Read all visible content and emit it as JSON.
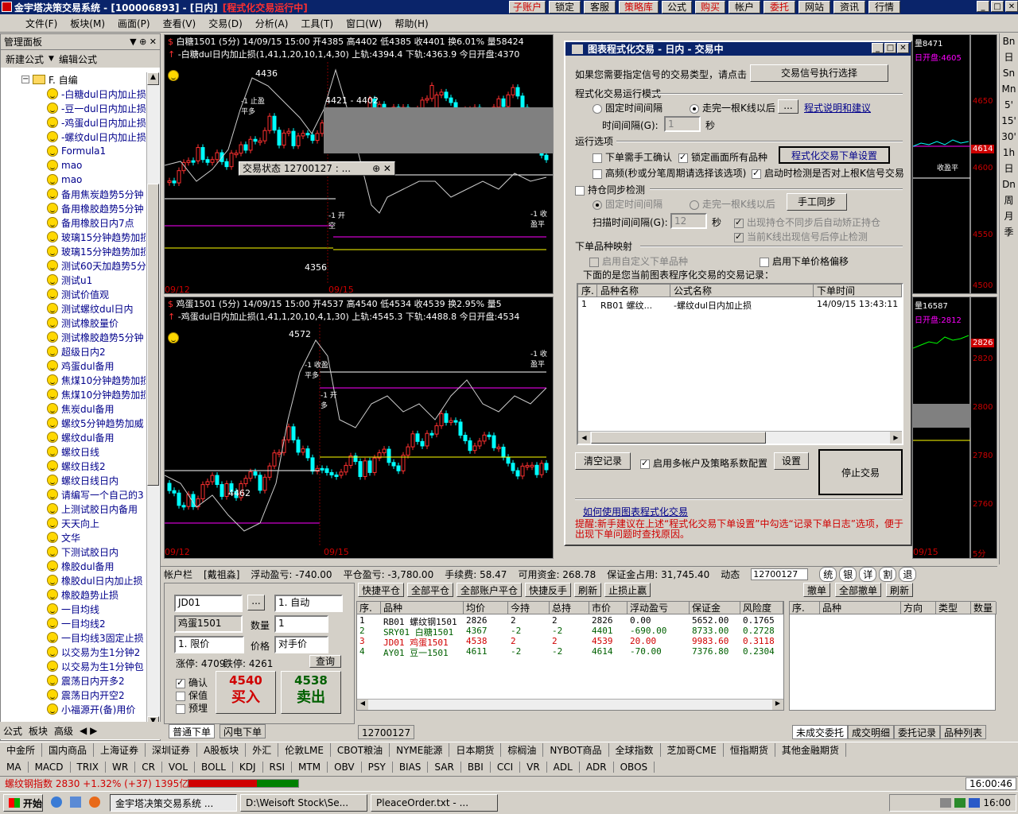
{
  "window": {
    "title": "金宇塔决策交易系统 - [100006893] - [日内]",
    "running_badge": "[程式化交易运行中]",
    "quick_buttons": [
      "子账户",
      "锁定",
      "客服",
      "策略库",
      "公式",
      "购买",
      "帐户",
      "委托",
      "网站",
      "资讯",
      "行情"
    ],
    "colors": {
      "title_bg": "#0a246a",
      "chart_bg": "#000000",
      "up": "#ff3030",
      "down": "#00ffff",
      "ui_face": "#d4d0c8"
    }
  },
  "menu": [
    "文件(F)",
    "板块(M)",
    "画面(P)",
    "查看(V)",
    "交易(D)",
    "分析(A)",
    "工具(T)",
    "窗口(W)",
    "帮助(H)"
  ],
  "left_panel": {
    "title": "管理面板",
    "new_formula": "新建公式",
    "edit_formula": "编辑公式",
    "folder": "F. 自编",
    "items": [
      "-白糖dul日内加止损",
      "-豆一dul日内加止损",
      "-鸡蛋dul日内加止损",
      "-螺纹dul日内加止损",
      "Formula1",
      "mao",
      "mao",
      "备用焦炭趋势5分钟",
      "备用橡胶趋势5分钟",
      "备用橡胶日内7点",
      "玻璃15分钟趋势加损",
      "玻璃15分钟趋势加损",
      "测试60天加趋势5分",
      "测试u1",
      "测试价值观",
      "测试螺纹dul日内",
      "测试橡胶量价",
      "测试橡胶趋势5分钟",
      "超级日内2",
      "鸡蛋dul备用",
      "焦煤10分钟趋势加损",
      "焦煤10分钟趋势加损",
      "焦炭dul备用",
      "螺纹5分钟趋势加威",
      "螺纹dul备用",
      "螺纹日线",
      "螺纹日线2",
      "螺纹日线日内",
      "请编写一个自己的3",
      "上测试胶日内备用",
      "天天向上",
      "文华",
      "下测试胶日内",
      "橡胶dul备用",
      "橡胶dul日内加止损",
      "橡胶趋势止损",
      "一目均线",
      "一目均线2",
      "一目均线3固定止损",
      "以交易为生1分钟2",
      "以交易为生1分钟包",
      "震荡日内开多2",
      "震荡日内开空2",
      "小福源开(备)用价"
    ],
    "tabs": [
      "公式",
      "板块",
      "高级"
    ]
  },
  "chart_top": {
    "header": "白糖1501 (5分) 14/09/15 15:00 开4385 高4402 低4385 收4401 换6.01% 量58424",
    "formula": "-白糖dul日内加止损(1,41,1,20,10,1,4,30) 上轨:4394.4 下轨:4363.9 今日开盘:4370",
    "labels": {
      "high": "4436",
      "low": "4356",
      "range": "4421 - 4402",
      "signal1": "-1 止盈平多",
      "signal2": "-1 开空",
      "signal3": "-1 收盈平",
      "date1": "09/12",
      "date2": "09/15",
      "period": "5分"
    },
    "right_header": "量8471",
    "right_open": "日开盘:4605",
    "axis": [
      "4650",
      "4614",
      "4600",
      "4550",
      "4500"
    ],
    "axis_highlight": "4614"
  },
  "chart_bottom": {
    "header": "鸡蛋1501 (5分) 14/09/15 15:00 开4537 高4540 低4534 收4539 换2.95% 量5",
    "formula": "-鸡蛋dul日内加止损(1,41,1,20,10,4,1,30) 上轨:4545.3 下轨:4488.8 今日开盘:4534",
    "labels": {
      "high": "4572",
      "low": "4462",
      "signal1": "-1 收盈平多",
      "signal2": "-1 开多",
      "signal3": "-1 收盈平",
      "date1": "09/12",
      "date2": "09/15",
      "period": "5分"
    },
    "right_header": "量16587",
    "right_open": "日开盘:2812",
    "axis": [
      "2826",
      "2820",
      "2800",
      "2780",
      "2760"
    ],
    "axis_highlight": "2826",
    "right_date": "09/15",
    "right_period": "5分"
  },
  "trade_status_popup": "交易状态 12700127 : ...",
  "dialog": {
    "title": "图表程式化交易 - 日内 - 交易中",
    "intro": "如果您需要指定信号的交易类型，请点击",
    "signal_btn": "交易信号执行选择",
    "mode_title": "程式化交易运行模式",
    "mode_fixed": "固定时间间隔",
    "mode_kline": "走完一根K线以后",
    "mode_link": "程式说明和建议",
    "interval_label": "时间间隔(G):",
    "interval_value": "1",
    "interval_unit": "秒",
    "run_title": "运行选项",
    "opt_manual": "下单需手工确认",
    "opt_lock": "锁定画面所有品种",
    "order_setting_btn": "程式化交易下单设置",
    "opt_freq": "高频(秒或分笔周期请选择该选项)",
    "opt_check": "启动时检测是否对上根K信号交易",
    "sync_title": "持仓同步检测",
    "sync_fixed": "固定时间间隔",
    "sync_kline": "走完一根K线以后",
    "sync_btn": "手工同步",
    "scan_label": "扫描时间间隔(G):",
    "scan_value": "12",
    "scan_unit": "秒",
    "sync_auto": "出现持仓不同步后自动矫正持仓",
    "sync_stop": "当前K线出现信号后停止检测",
    "map_title": "下单品种映射",
    "map_custom": "启用自定义下单品种",
    "map_offset": "启用下单价格偏移",
    "records_title": "下面的是您当前图表程序化交易的交易记录：",
    "columns": [
      "序.",
      "品种名称",
      "公式名称",
      "下单时间"
    ],
    "records": [
      {
        "no": "1",
        "symbol": "RB01 螺纹...",
        "formula": "-螺纹dul日内加止损",
        "time": "14/09/15 13:43:11"
      }
    ],
    "clear_btn": "清空记录",
    "multi_acc": "启用多帐户及策略系数配置",
    "setting_btn": "设置",
    "stop_btn": "停止交易",
    "howto_link": "如何使用图表程式化交易",
    "tip": "提醒:新手建议在上述“程式化交易下单设置”中勾选“记录下单日志”选项，便于出现下单问题时查找原因。"
  },
  "account_bar": {
    "label": "帐户栏",
    "name": "[戴祖淼]",
    "float_pl": "浮动盈亏: -740.00",
    "close_pl": "平仓盈亏: -3,780.00",
    "fee": "手续费: 58.47",
    "avail": "可用资金: 268.78",
    "margin": "保证金占用: 31,745.40",
    "dynamic": "动态",
    "account_select": "12700127",
    "mini_btns": [
      "统",
      "银",
      "详",
      "割",
      "退"
    ]
  },
  "order_panel": {
    "symbol_code": "JD01",
    "symbol_name": "鸡蛋1501",
    "mode": "1. 自动",
    "qty_label": "数量",
    "qty": "1",
    "price_type": "1. 限价",
    "price_label": "价格",
    "price": "对手价",
    "limit_up": "涨停: 4709",
    "limit_down": "跌停: 4261",
    "query_btn": "查询",
    "confirm": "确认",
    "keep": "保值",
    "preorder": "预埋",
    "buy_price": "4540",
    "buy_label": "买入",
    "sell_price": "4538",
    "sell_label": "卖出",
    "tabs": [
      "普通下单",
      "闪电下单"
    ]
  },
  "positions": {
    "toolbar": [
      "快捷平仓",
      "全部平仓",
      "全部账户平仓",
      "快捷反手",
      "刷新",
      "止损止赢"
    ],
    "columns": [
      "序.",
      "品种",
      "均价",
      "今持",
      "总持",
      "市价",
      "浮动盈亏",
      "保证金",
      "风险度"
    ],
    "rows": [
      {
        "no": "1",
        "symbol": "RB01 螺纹钢1501",
        "avg": "2826",
        "today": "2",
        "total": "2",
        "market": "2826",
        "pl": "0.00",
        "margin": "5652.00",
        "risk": "0.1765"
      },
      {
        "no": "2",
        "symbol": "SRY01 白糖1501",
        "avg": "4367",
        "today": "-2",
        "total": "-2",
        "market": "4401",
        "pl": "-690.00",
        "margin": "8733.00",
        "risk": "0.2728"
      },
      {
        "no": "3",
        "symbol": "JD01 鸡蛋1501",
        "avg": "4538",
        "today": "2",
        "total": "2",
        "market": "4539",
        "pl": "20.00",
        "margin": "9983.60",
        "risk": "0.3118"
      },
      {
        "no": "4",
        "symbol": "AY01 豆一1501",
        "avg": "4611",
        "today": "-2",
        "total": "-2",
        "market": "4614",
        "pl": "-70.00",
        "margin": "7376.80",
        "risk": "0.2304"
      }
    ],
    "account_tab": "12700127"
  },
  "orders": {
    "toolbar": [
      "撤单",
      "全部撤单",
      "刷新"
    ],
    "columns": [
      "序.",
      "品种",
      "方向",
      "类型",
      "数量"
    ],
    "tabs": [
      "未成交委托",
      "成交明细",
      "委托记录",
      "品种列表"
    ]
  },
  "market_tabs": [
    "中金所",
    "国内商品",
    "上海证券",
    "深圳证券",
    "A股板块",
    "外汇",
    "伦敦LME",
    "CBOT粮油",
    "NYME能源",
    "日本期货",
    "棕榈油",
    "NYBOT商品",
    "全球指数",
    "芝加哥CME",
    "恒指期货",
    "其他金融期货"
  ],
  "indicator_tabs": [
    "MA",
    "MACD",
    "TRIX",
    "WR",
    "CR",
    "VOL",
    "BOLL",
    "KDJ",
    "RSI",
    "MTM",
    "OBV",
    "PSY",
    "BIAS",
    "SAR",
    "BBI",
    "CCI",
    "VR",
    "ADL",
    "ADR",
    "OBOS"
  ],
  "status": {
    "index": "螺纹钢指数 2830 +1.32% (+37) 1395亿",
    "time": "16:00:46"
  },
  "right_strip": [
    "Bn",
    "日",
    "Sn",
    "Mn",
    "5'",
    "15'",
    "30'",
    "1h",
    "日",
    "Dn",
    "周",
    "月",
    "季"
  ],
  "taskbar": {
    "start": "开始",
    "tasks": [
      "金宇塔决策交易系统 ...",
      "D:\\Weisoft Stock\\Se...",
      "PleaceOrder.txt - ..."
    ],
    "clock": "16:00"
  }
}
